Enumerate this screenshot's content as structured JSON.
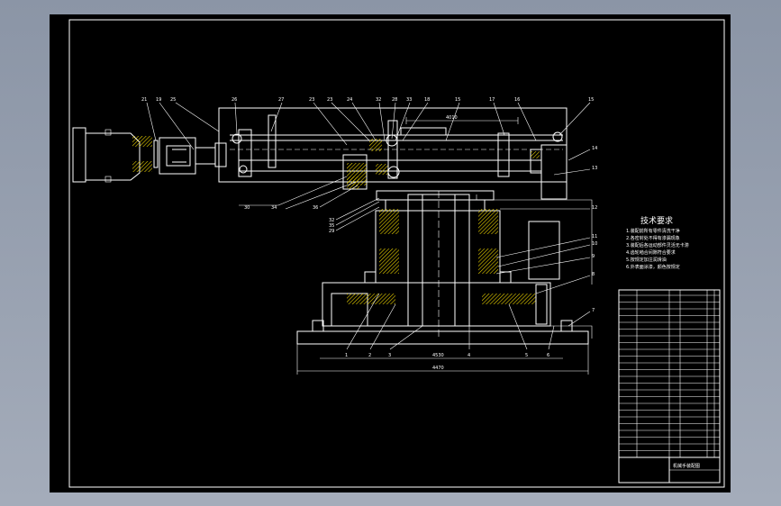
{
  "colors": {
    "background": "#9aa2b1",
    "sheet": "#000000",
    "lines": "#ffffff",
    "hatch_yellow": "#e8d000"
  },
  "part_numbers_top": [
    "21",
    "19",
    "25",
    "26",
    "27",
    "23",
    "23",
    "24",
    "32",
    "28",
    "33",
    "18",
    "15",
    "17",
    "16",
    "15"
  ],
  "part_numbers_right": [
    "14",
    "13",
    "12",
    "11",
    "10",
    "9",
    "8",
    "7"
  ],
  "part_numbers_lower": [
    "30",
    "34",
    "36",
    "32",
    "35",
    "29"
  ],
  "part_numbers_bottom": [
    "1",
    "2",
    "3",
    "4",
    "5",
    "6"
  ],
  "dim_text": {
    "top_dim": "4010",
    "base_dim": "4470",
    "inner_dim": "4530"
  },
  "tech_requirements": {
    "title": "技术要求",
    "lines": [
      "1.装配前所有零件清洗干净",
      "2.各密封处不得有渗漏现象",
      "3.装配后各运动部件灵活无卡滞",
      "4.齿轮啮合间隙符合要求",
      "5.按规定加注润滑油",
      "6.外表面涂漆，颜色按规定"
    ]
  },
  "title_block": {
    "name": "机械手装配图"
  }
}
